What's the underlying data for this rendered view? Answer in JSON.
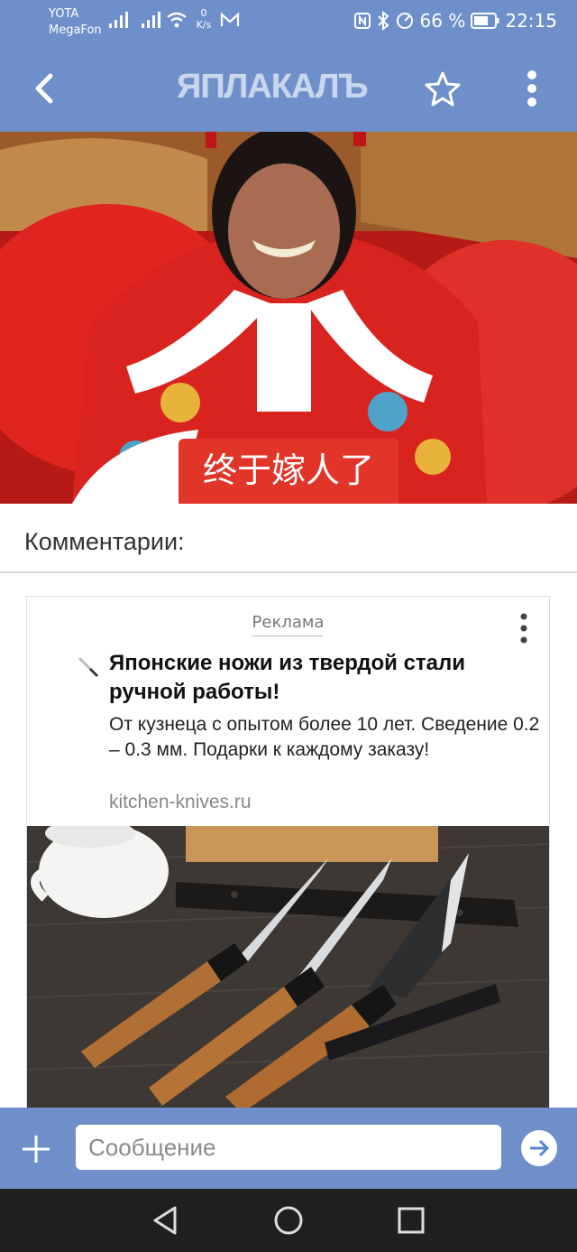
{
  "status_bar": {
    "carrier_1": "YOTA",
    "carrier_2": "MegaFon",
    "speed_value": "0",
    "speed_unit": "K/s",
    "battery": "66 %",
    "time": "22:15"
  },
  "app_bar": {
    "logo": "ЯПЛАКАЛЪ"
  },
  "post": {
    "image_caption": "终于嫁人了"
  },
  "comments": {
    "title": "Комментарии:"
  },
  "ad": {
    "label": "Реклама",
    "title": "Японские ножи из твердой стали ручной работы!",
    "description": "От кузнеца с опытом более 10 лет. Сведение 0.2 – 0.3 мм. Подарки к каждому заказу!",
    "domain": "kitchen-knives.ru"
  },
  "composer": {
    "placeholder": "Сообщение"
  },
  "colors": {
    "bar": "#6e8fc9",
    "nav": "#1f1f1f"
  }
}
